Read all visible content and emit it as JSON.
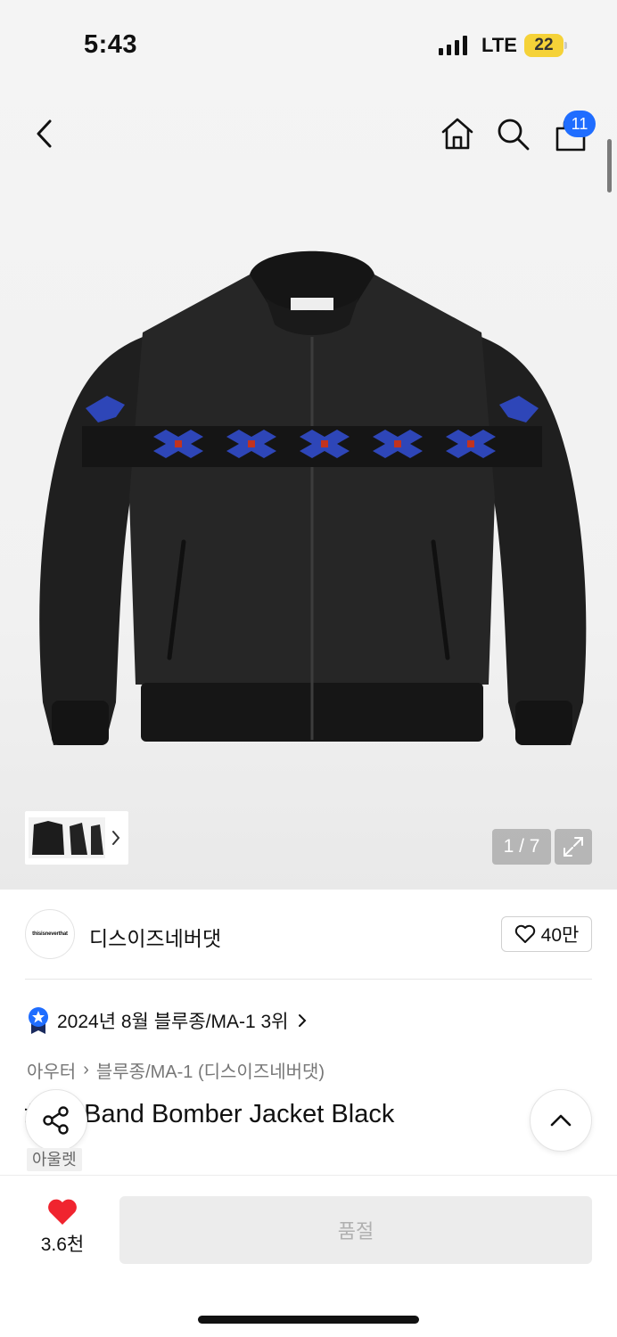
{
  "status_bar": {
    "time": "5:43",
    "network": "LTE",
    "battery": "22"
  },
  "nav": {
    "cart_count": "11"
  },
  "gallery": {
    "page_counter": "1 / 7",
    "current_page": 1,
    "total_pages": 7
  },
  "brand": {
    "logo_text": "thisisneverthat",
    "name": "디스이즈네버댓",
    "likes": "40만"
  },
  "ranking": {
    "text": "2024년 8월 블루종/MA-1 3위"
  },
  "breadcrumb": {
    "category": "아우터",
    "separator": "›",
    "subcategory": "블루종/MA-1 (디스이즈네버댓)"
  },
  "product": {
    "title": "Bandana Band Bomber Jacket Black",
    "tag": "아울렛"
  },
  "bottom_bar": {
    "like_count": "3.6천",
    "buy_label": "품절"
  },
  "colors": {
    "accent_blue": "#1f6dff",
    "heart_red": "#f0242f",
    "battery_yellow": "#f5d238"
  }
}
